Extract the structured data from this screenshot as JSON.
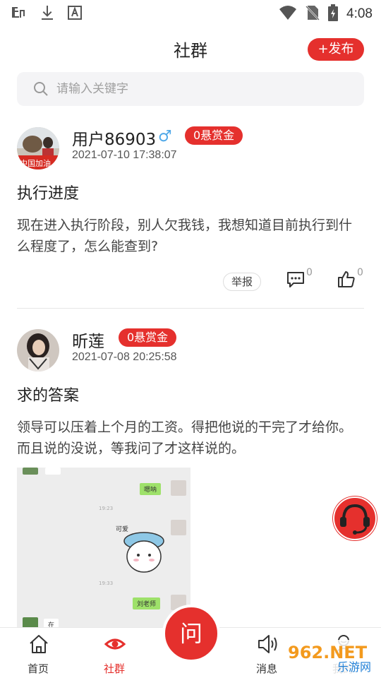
{
  "status_bar": {
    "time": "4:08",
    "icons": [
      "bug-icon",
      "download-icon",
      "font-icon",
      "wifi-icon",
      "no-sim-icon",
      "battery-icon"
    ]
  },
  "header": {
    "title": "社群",
    "publish_label": "+发布"
  },
  "search": {
    "placeholder": "请输入关键字"
  },
  "posts": [
    {
      "user": "用户86903",
      "gender": "♂",
      "bounty": "0悬赏金",
      "time": "2021-07-10 17:38:07",
      "title": "执行进度",
      "body": "现在进入执行阶段，别人欠我钱，我想知道目前执行到什么程度了，怎么能查到?",
      "report_label": "举报",
      "comments": "0",
      "likes": "0",
      "avatar_text": "中国加油"
    },
    {
      "user": "昕莲",
      "bounty": "0悬赏金",
      "time": "2021-07-08 20:25:58",
      "title": "求的答案",
      "body": "领导可以压着上个月的工资。得把他说的干完了才给你。而且说的没说，等我问了才这样说的。",
      "image": {
        "bubble1": "嗯呐",
        "time1": "19:23",
        "sticker_text": "可爱",
        "time2": "19:33",
        "bubble2": "刘老师",
        "bottom_text": "在"
      }
    }
  ],
  "tabbar": {
    "tabs": [
      {
        "label": "首页",
        "icon": "home-icon"
      },
      {
        "label": "社群",
        "icon": "eye-icon",
        "active": true
      },
      {
        "label": "消息",
        "icon": "speaker-icon"
      },
      {
        "label": "我的",
        "icon": "user-icon"
      }
    ],
    "center_label": "问"
  },
  "watermark": {
    "top": "962.NET",
    "bottom": "乐游网"
  },
  "colors": {
    "accent": "#e5302d",
    "male": "#4fa8e8"
  }
}
